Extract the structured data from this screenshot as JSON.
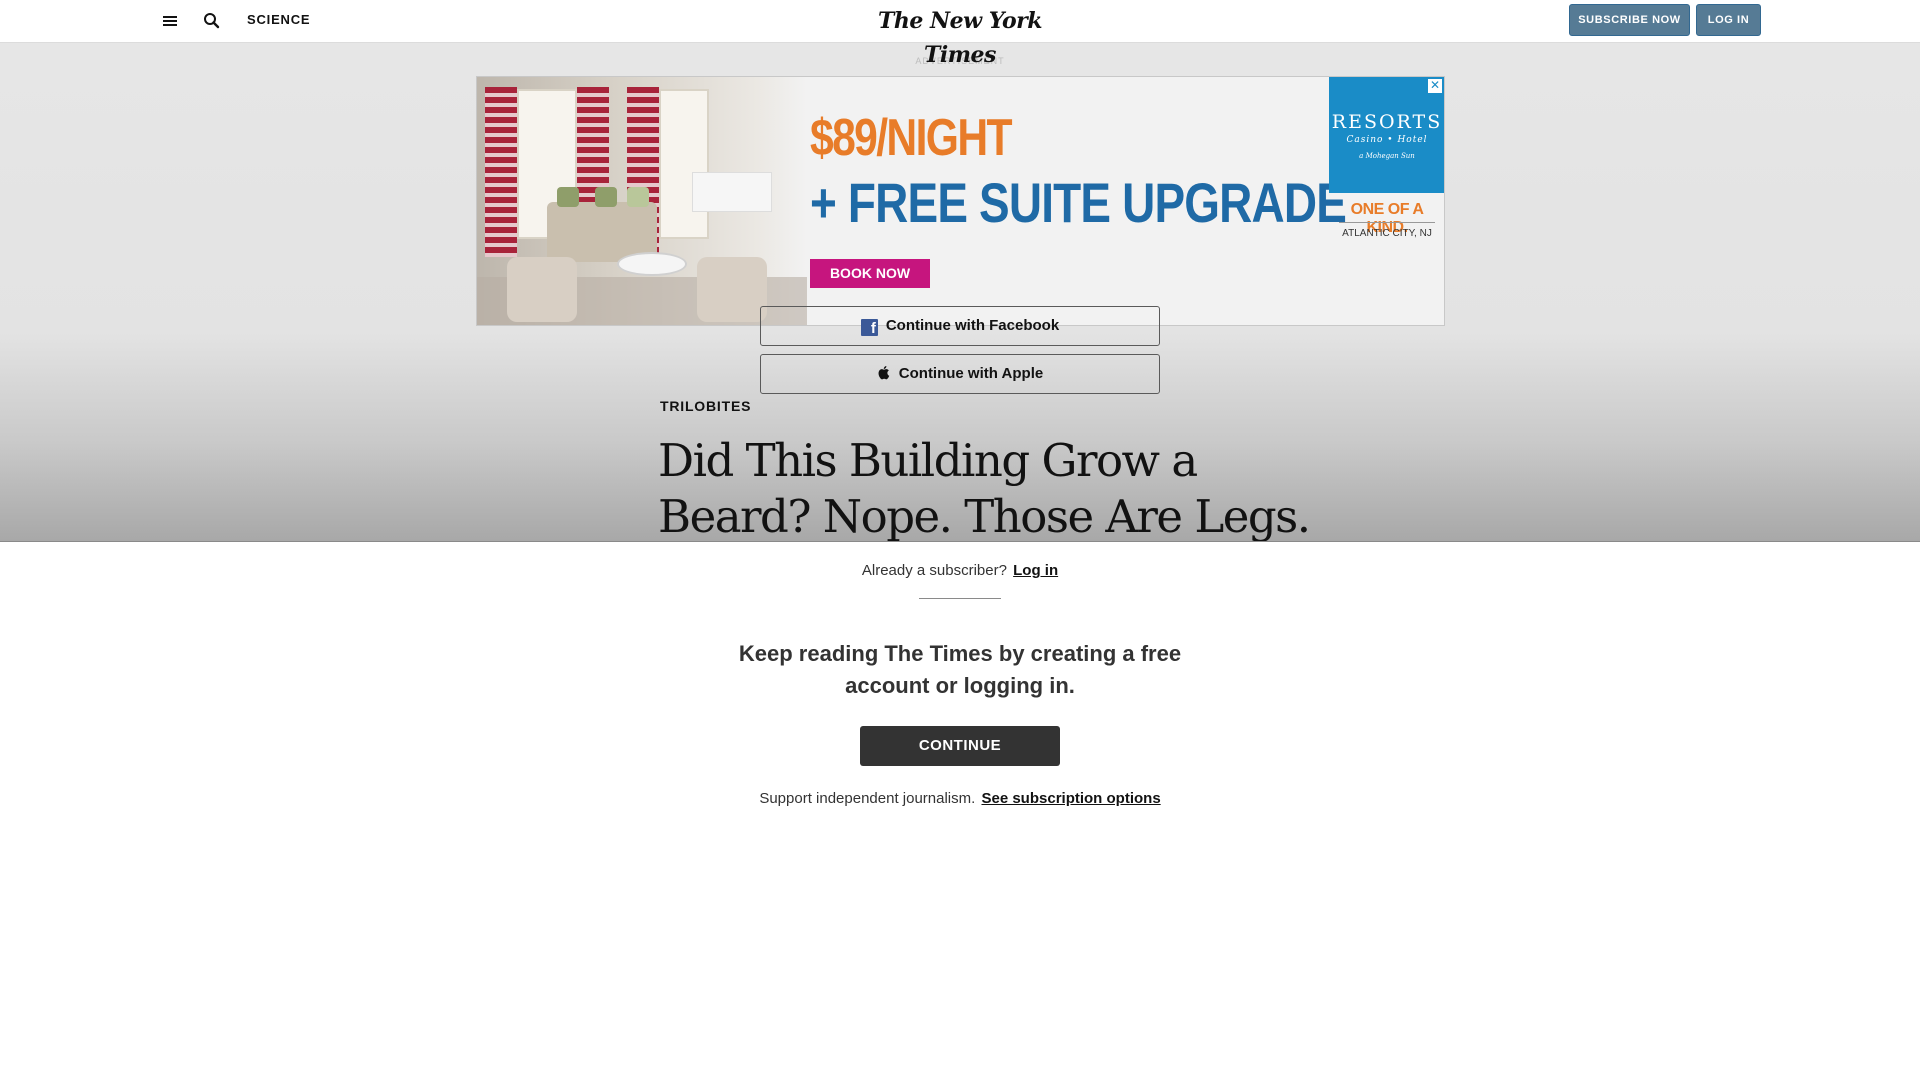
{
  "header": {
    "section": "SCIENCE",
    "logo": "The New York Times",
    "subscribe_label": "SUBSCRIBE NOW",
    "login_label": "LOG IN"
  },
  "ad": {
    "label": "ADVERTISEMENT",
    "price": "$89/NIGHT",
    "offer": "+ FREE SUITE UPGRADE",
    "cta": "BOOK NOW",
    "brand": "RESORTS",
    "brand_sub": "Casino • Hotel",
    "brand_sub2": "a Mohegan Sun",
    "tagline": "ONE OF A KIND.",
    "location": "ATLANTIC CITY, NJ",
    "close_glyph": "✕"
  },
  "article": {
    "kicker": "TRILOBITES",
    "headline": "Did This Building Grow a Beard? Nope. Those Are Legs."
  },
  "social": {
    "facebook_label": "Continue with Facebook",
    "apple_label": "Continue with Apple"
  },
  "gateway": {
    "already_text": "Already a subscriber?",
    "login_link": "Log in",
    "title": "Keep reading The Times by creating a free account or logging in.",
    "continue_label": "CONTINUE",
    "support_text": "Support independent journalism.",
    "subscription_link": "See subscription options"
  },
  "icons": {
    "menu": "menu-icon",
    "search": "search-icon",
    "facebook": "facebook-icon",
    "apple": "apple-icon",
    "close": "close-icon"
  },
  "colors": {
    "header_button": "#567b95",
    "continue_button": "#333333",
    "ad_orange": "#e87c29",
    "ad_blue": "#1f6aa6",
    "ad_pink": "#c6157e",
    "facebook_blue": "#3b5998"
  }
}
